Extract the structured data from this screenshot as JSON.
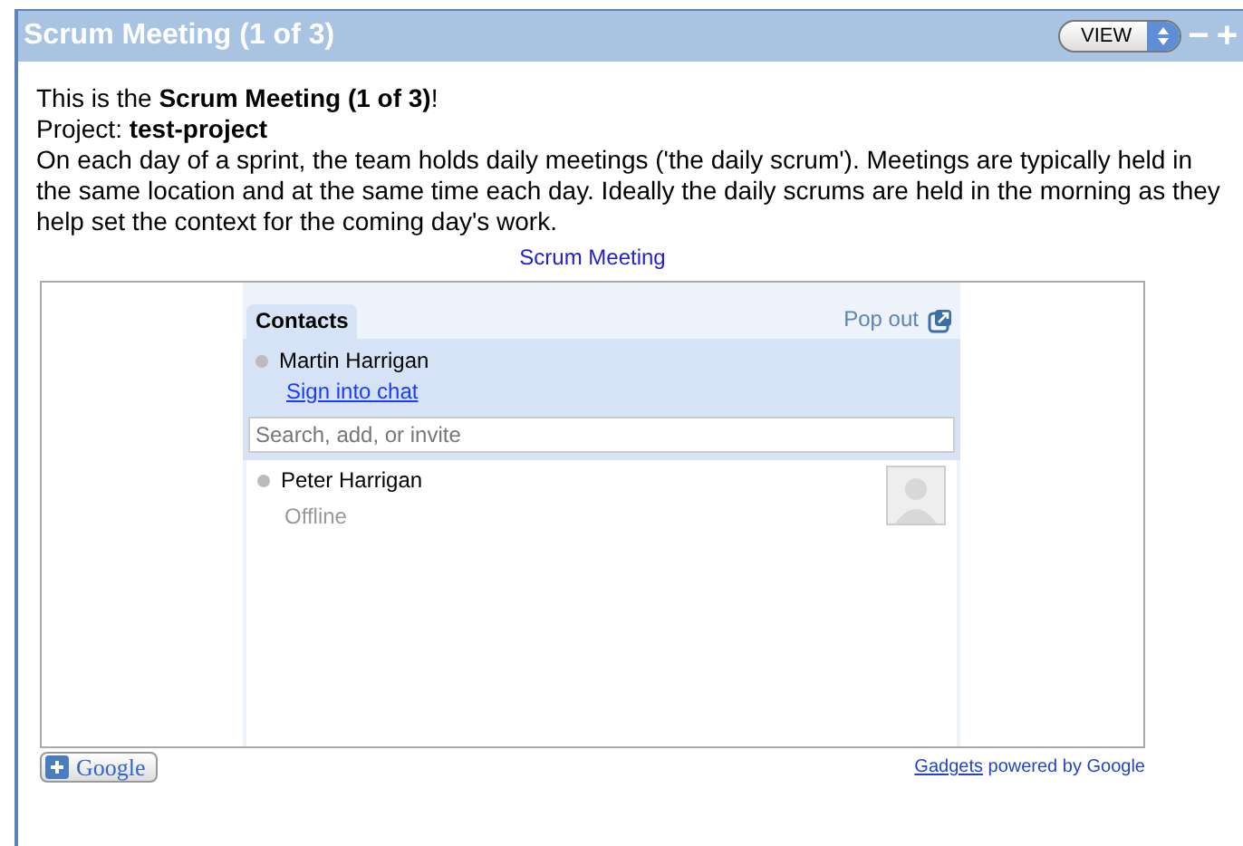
{
  "window": {
    "title": "Scrum Meeting (1 of 3)",
    "view_button": "VIEW",
    "minimize": "−",
    "maximize": "+"
  },
  "intro": [
    "This is the **Scrum Meeting (1 of 3)**!",
    "Project: **test-project**",
    "On each day of a sprint, the team holds daily meetings ('the daily scrum'). Meetings are typically held in the same location and at the same time each day. Ideally the daily scrums are held in the morning as they help set the context for the coming day's work."
  ],
  "gadget_title": "Scrum Meeting",
  "contacts": {
    "tab": "Contacts",
    "pop_out": "Pop out",
    "me": {
      "name": "Martin Harrigan",
      "link": "Sign into chat"
    },
    "search": {
      "placeholder": "Search, add, or invite"
    },
    "list": [
      {
        "name": "Peter Harrigan",
        "status": "Offline"
      }
    ]
  },
  "footer": {
    "add_button": "Google",
    "link": "Gadgets",
    "text": " powered by Google"
  }
}
